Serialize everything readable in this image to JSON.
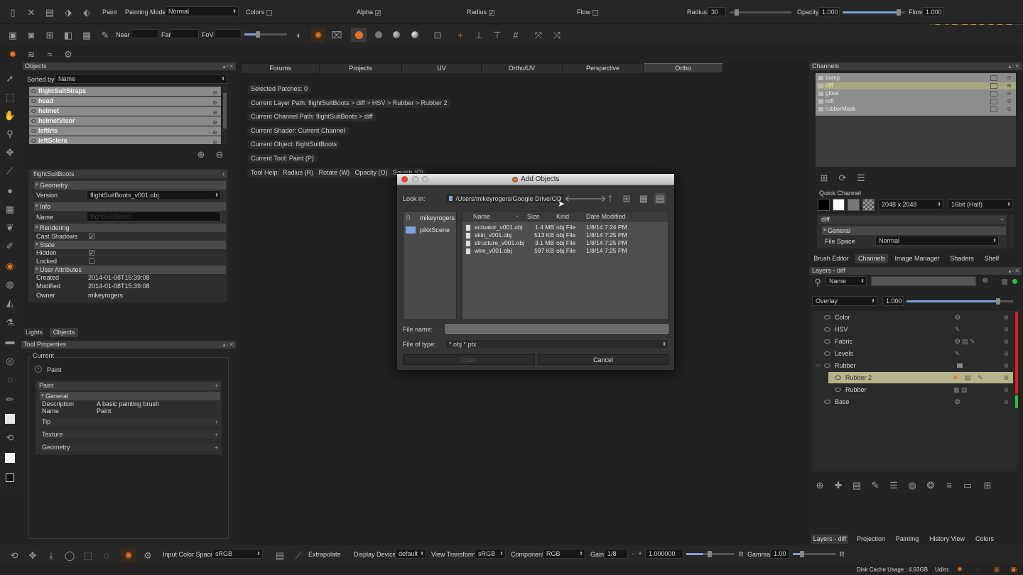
{
  "watermark": "fxphd",
  "topbar": {
    "paint_label": "Paint",
    "painting_mode_label": "Painting Mode",
    "painting_mode_value": "Normal",
    "colors_label": "Colors",
    "alpha_label": "Alpha",
    "radius_check_label": "Radius",
    "flow_check_label": "Flow",
    "radius_label": "Radius",
    "radius_value": "30",
    "opacity_label": "Opacity",
    "opacity_value": "1.000",
    "flow_label": "Flow",
    "flow_value": "1.000",
    "near_label": "Near",
    "far_label": "Far",
    "fov_label": "FoV"
  },
  "objects_panel": {
    "title": "Objects",
    "sorted_by_label": "Sorted by",
    "sorted_by_value": "Name",
    "items": [
      "flightSuitStraps",
      "head",
      "helmet",
      "helmetVisor",
      "leftIris",
      "leftSclera"
    ]
  },
  "props_panel": {
    "title": "flightSuitBoots",
    "geometry": "Geometry",
    "version_label": "Version",
    "version_value": "flightSuitBoots_v001.obj",
    "info": "Info",
    "name_label": "Name",
    "name_value": "flightSuitBoots",
    "rendering": "Rendering",
    "cast_shadows": "Cast Shadows",
    "state": "State",
    "hidden": "Hidden",
    "locked": "Locked",
    "user_attributes": "User Attributes",
    "created_label": "Created",
    "created_value": "2014-01-08T15:39:08",
    "modified_label": "Modified",
    "modified_value": "2014-01-08T15:39:08",
    "owner_label": "Owner",
    "owner_value": "mikeyrogers"
  },
  "left_tabs": [
    "Lights",
    "Objects"
  ],
  "tool_props": {
    "title": "Tool Properties",
    "current": "Current",
    "current_tool": "Paint",
    "paint": "Paint",
    "general": "General",
    "description_label": "Description",
    "description_value": "A basic painting brush",
    "name_label": "Name",
    "name_value": "Paint",
    "tip": "Tip",
    "texture": "Texture",
    "geometry": "Geometry"
  },
  "viewport_tabs": [
    "Forums",
    "Projects",
    "UV",
    "Ortho/UV",
    "Perspective",
    "Ortho"
  ],
  "viewport_info": [
    "Selected Patches: 0",
    "Current Layer Path: flightSuitBoots > diff > HSV > Rubber > Rubber 2",
    "Current Channel Path: flightSuitBoots > diff",
    "Current Shader: Current Channel",
    "Current Object: flightSuitBoots",
    "Current Tool: Paint (P)",
    "Tool Help:  Radius (R)   Rotate (W)   Opacity (O)   Squish (Q)"
  ],
  "dialog": {
    "title": "Add Objects",
    "look_in_label": "Look in:",
    "look_in_value": "/Users/mikeyrogers/Google Drive/CG",
    "places": [
      "mikeyrogers",
      "pilotScene"
    ],
    "columns": [
      "Name",
      "Size",
      "Kind",
      "Date Modified"
    ],
    "files": [
      {
        "name": "actuator_v001.obj",
        "size": "1.4 MB",
        "kind": "obj File",
        "date": "1/8/14 7:24 PM"
      },
      {
        "name": "skin_v001.obj",
        "size": "513 KB",
        "kind": "obj File",
        "date": "1/8/14 7:25 PM"
      },
      {
        "name": "structure_v001.obj",
        "size": "3.1 MB",
        "kind": "obj File",
        "date": "1/8/14 7:25 PM"
      },
      {
        "name": "wire_v001.obj",
        "size": "597 KB",
        "kind": "obj File",
        "date": "1/8/14 7:25 PM"
      }
    ],
    "file_name_label": "File name:",
    "file_name_value": "",
    "file_type_label": "File of type:",
    "file_type_value": "*.obj *.ptx",
    "open_label": "Open",
    "cancel_label": "Cancel"
  },
  "channels_panel": {
    "title": "Channels",
    "items": [
      "bump",
      "diff",
      "gloss",
      "refl",
      "rubberMask"
    ]
  },
  "quick_channel": {
    "label": "Quick Channel",
    "size_value": "2048 x 2048",
    "depth_value": "16bit (Half)",
    "channel_name": "diff",
    "general": "General",
    "file_space_label": "File Space",
    "file_space_value": "Normal"
  },
  "right_tabs": [
    "Brush Editor",
    "Channels",
    "Image Manager",
    "Shaders",
    "Shelf"
  ],
  "layers_panel": {
    "title": "Layers - diff",
    "search_mode": "Name",
    "blend_mode": "Overlay",
    "opacity_value": "1.000",
    "layers": [
      "Color",
      "HSV",
      "Fabric",
      "Levels",
      "Rubber",
      "Rubber 2",
      "Rubber",
      "Base"
    ]
  },
  "bottom_right_tabs": [
    "Layers - diff",
    "Projection",
    "Painting",
    "History View",
    "Colors"
  ],
  "statusbar": {
    "input_color_space_label": "Input Color Space",
    "input_color_space_value": "sRGB",
    "extrapolate_label": "Extrapolate",
    "display_device_label": "Display Device",
    "display_device_value": "default",
    "view_transform_label": "View Transform",
    "view_transform_value": "sRGB",
    "component_label": "Component",
    "component_value": "RGB",
    "gain_label": "Gain",
    "gain_value": "1/8",
    "exposure_value": "1.000000",
    "gamma_label": "Gamma",
    "gamma_value": "1.00",
    "channel_r": "R",
    "disk_cache": "Disk Cache Usage : 4.93GB",
    "udim_label": "Udim:"
  },
  "colors": {
    "accent_orange": "#e8731f",
    "layer_selected": "#b8b48a",
    "slider_blue": "#7f9fd5",
    "bar_red": "#d21f1f",
    "bar_green": "#2fbf3f"
  }
}
